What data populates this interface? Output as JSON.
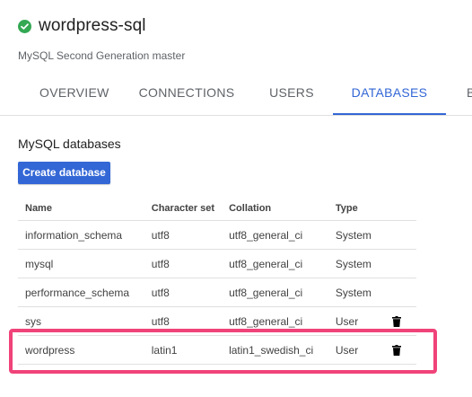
{
  "instance": {
    "title": "wordpress-sql",
    "subtitle": "MySQL Second Generation master",
    "status_color": "#34a853"
  },
  "tabs": [
    {
      "label": "OVERVIEW",
      "active": false
    },
    {
      "label": "CONNECTIONS",
      "active": false
    },
    {
      "label": "USERS",
      "active": false
    },
    {
      "label": "DATABASES",
      "active": true
    },
    {
      "label": "B",
      "active": false
    }
  ],
  "section": {
    "title": "MySQL databases",
    "create_button": "Create database"
  },
  "table": {
    "headers": [
      "Name",
      "Character set",
      "Collation",
      "Type"
    ],
    "rows": [
      {
        "name": "information_schema",
        "charset": "utf8",
        "collation": "utf8_general_ci",
        "type": "System",
        "deletable": false
      },
      {
        "name": "mysql",
        "charset": "utf8",
        "collation": "utf8_general_ci",
        "type": "System",
        "deletable": false
      },
      {
        "name": "performance_schema",
        "charset": "utf8",
        "collation": "utf8_general_ci",
        "type": "System",
        "deletable": false
      },
      {
        "name": "sys",
        "charset": "utf8",
        "collation": "utf8_general_ci",
        "type": "User",
        "deletable": true
      },
      {
        "name": "wordpress",
        "charset": "latin1",
        "collation": "latin1_swedish_ci",
        "type": "User",
        "deletable": true
      }
    ]
  },
  "colors": {
    "accent": "#3367d6",
    "highlight": "#f0437a"
  }
}
